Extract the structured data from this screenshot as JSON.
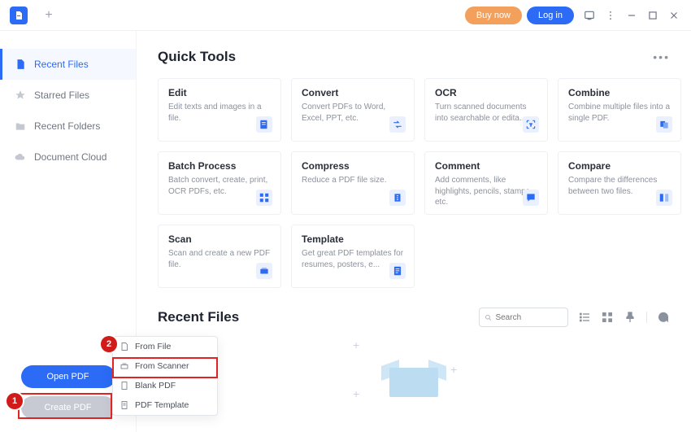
{
  "titlebar": {
    "buy_label": "Buy now",
    "login_label": "Log in"
  },
  "sidebar": {
    "items": [
      {
        "label": "Recent Files"
      },
      {
        "label": "Starred Files"
      },
      {
        "label": "Recent Folders"
      },
      {
        "label": "Document Cloud"
      }
    ],
    "open_pdf_label": "Open PDF",
    "create_pdf_label": "Create PDF"
  },
  "quick_tools": {
    "title": "Quick Tools",
    "cards": [
      {
        "title": "Edit",
        "desc": "Edit texts and images in a file."
      },
      {
        "title": "Convert",
        "desc": "Convert PDFs to Word, Excel, PPT, etc."
      },
      {
        "title": "OCR",
        "desc": "Turn scanned documents into searchable or edita..."
      },
      {
        "title": "Combine",
        "desc": "Combine multiple files into a single PDF."
      },
      {
        "title": "Batch Process",
        "desc": "Batch convert, create, print, OCR PDFs, etc."
      },
      {
        "title": "Compress",
        "desc": "Reduce a PDF file size."
      },
      {
        "title": "Comment",
        "desc": "Add comments, like highlights, pencils, stamps, etc."
      },
      {
        "title": "Compare",
        "desc": "Compare the differences between two files."
      },
      {
        "title": "Scan",
        "desc": "Scan and create a new PDF file."
      },
      {
        "title": "Template",
        "desc": "Get great PDF templates for resumes, posters, e..."
      }
    ]
  },
  "recent": {
    "title": "Recent Files",
    "search_placeholder": "Search"
  },
  "context_menu": {
    "items": [
      {
        "label": "From File"
      },
      {
        "label": "From Scanner"
      },
      {
        "label": "Blank PDF"
      },
      {
        "label": "PDF Template"
      }
    ]
  },
  "annotations": {
    "num1": "1",
    "num2": "2"
  }
}
